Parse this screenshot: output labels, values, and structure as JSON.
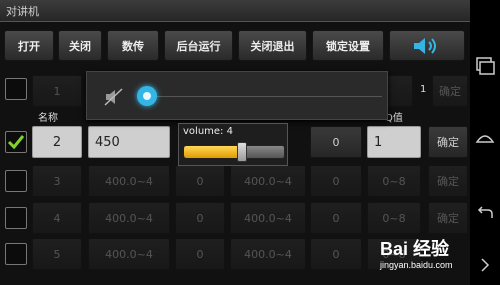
{
  "app": {
    "title": "对讲机"
  },
  "toolbar": {
    "open": "打开",
    "close": "关闭",
    "data_transfer": "数传",
    "background_run": "后台运行",
    "close_exit": "关闭退出",
    "lock_settings": "锁定设置",
    "volume_icon": "speaker-icon"
  },
  "table": {
    "headers": {
      "name": "名称",
      "q_value": "Q值"
    },
    "rows": [
      {
        "num": "1",
        "freq": "",
        "b": "",
        "range": "",
        "c": "",
        "q": "",
        "action": "确定",
        "checked": false,
        "dim": true
      },
      {
        "num": "2",
        "freq": "450",
        "b": "",
        "range": "",
        "c": "0",
        "q": "1",
        "action": "确定",
        "checked": true,
        "dim": false
      },
      {
        "num": "3",
        "freq": "400.0~4",
        "b": "0",
        "range": "400.0~4",
        "c": "0",
        "q": "0~8",
        "action": "确定",
        "checked": false,
        "dim": true
      },
      {
        "num": "4",
        "freq": "400.0~4",
        "b": "0",
        "range": "400.0~4",
        "c": "0",
        "q": "0~8",
        "action": "确定",
        "checked": false,
        "dim": true
      },
      {
        "num": "5",
        "freq": "400.0~4",
        "b": "0",
        "range": "400.0~4",
        "c": "0",
        "q": "0~8",
        "action": "确定",
        "checked": false,
        "dim": true
      }
    ],
    "row1_extra": "1"
  },
  "quick_settings": {
    "mute_icon": "mute-speaker-icon",
    "slider_icon": "slider-knob-icon"
  },
  "volume": {
    "label": "volume: 4",
    "level_fraction": 0.58
  },
  "watermark": {
    "logo": "Bai 经验",
    "url": "jingyan.baidu.com"
  },
  "colors": {
    "accent_blue": "#33b5e5",
    "slider_yellow": "#f2b600",
    "check_green": "#7fd12b"
  }
}
